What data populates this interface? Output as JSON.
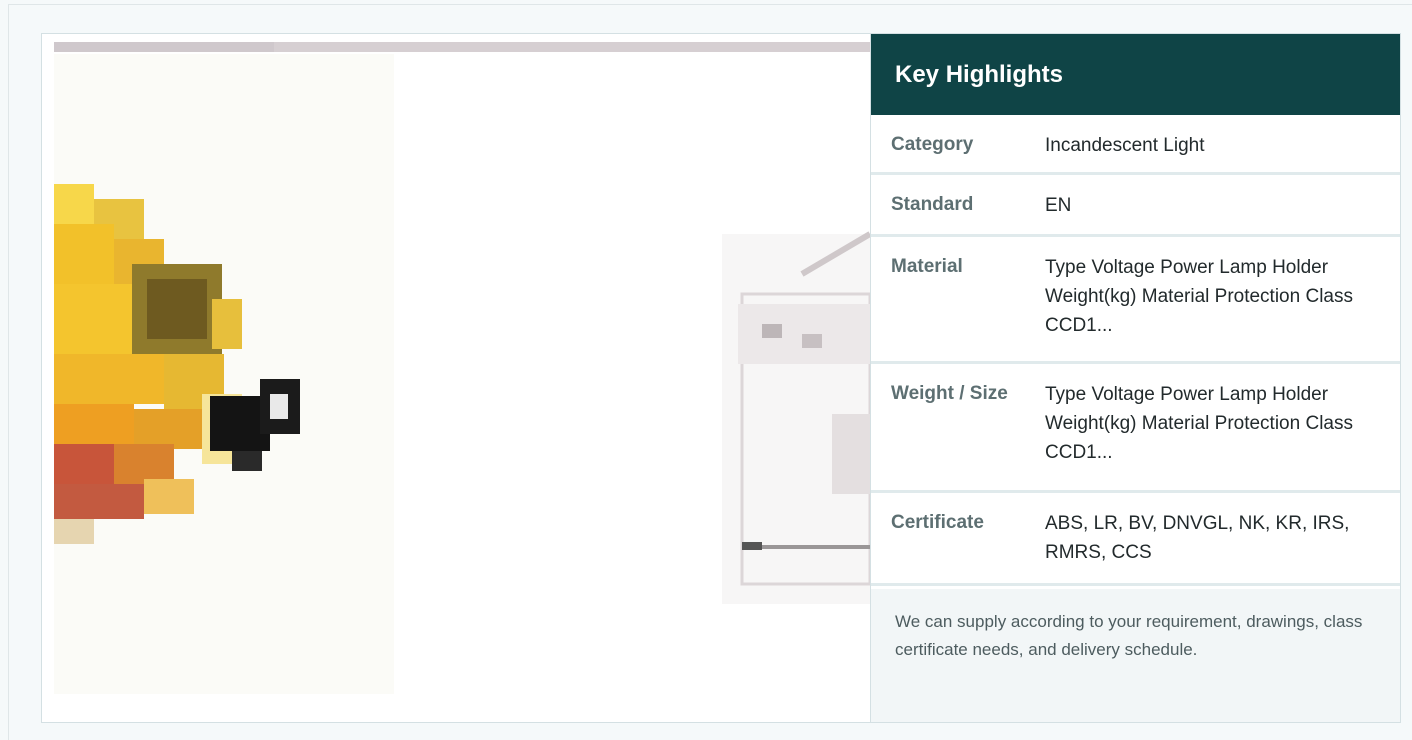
{
  "highlights": {
    "title": "Key Highlights",
    "rows": [
      {
        "label": "Category",
        "value": "Incandescent Light"
      },
      {
        "label": "Standard",
        "value": "EN"
      },
      {
        "label": "Material",
        "value": "Type Voltage Power Lamp Holder Weight(kg) Material Protection Class CCD1..."
      },
      {
        "label": "Weight / Size",
        "value": "Type Voltage Power Lamp Holder Weight(kg) Material Protection Class CCD1..."
      },
      {
        "label": "Certificate",
        "value": "ABS, LR, BV, DNVGL, NK, KR, IRS, RMRS, CCS"
      }
    ],
    "note": "We can supply according to your requirement, drawings, class certificate needs, and delivery schedule."
  },
  "product_image": {
    "subject": "yellow incandescent marine light fixture with technical drawing"
  },
  "colors": {
    "header_bg": "#0f4446",
    "page_bg": "#f5f9fa",
    "label_text": "#5d6f72",
    "value_text": "#222a2c"
  }
}
